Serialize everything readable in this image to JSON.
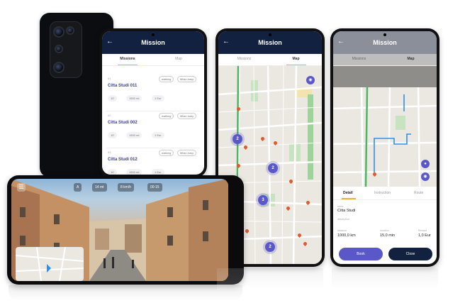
{
  "missions_screen": {
    "back_icon": "arrow-left-icon",
    "title": "Mission",
    "tabs": [
      "Missions",
      "Map"
    ],
    "missions": [
      {
        "number": "#1",
        "tags": [
          "walking",
          "Milan easy"
        ],
        "name": "Citta Studi 011",
        "stats": [
          "10'",
          "1500 mt",
          "1 Eur"
        ]
      },
      {
        "number": "#2",
        "tags": [
          "walking",
          "Milan easy"
        ],
        "name": "Citta Studi 002",
        "stats": [
          "10'",
          "1500 mt",
          "1 Eur"
        ]
      },
      {
        "number": "#3",
        "tags": [
          "walking",
          "Milan easy"
        ],
        "name": "Citta Studi 012",
        "stats": [
          "10'",
          "1500 mt",
          "1 Eur"
        ]
      }
    ]
  },
  "map_screen": {
    "title": "Mission",
    "tabs": [
      "Missions",
      "Map"
    ],
    "clusters": [
      "2",
      "2",
      "3",
      "2"
    ]
  },
  "detail_screen": {
    "title": "Mission",
    "tabs": [
      "Missions",
      "Map"
    ],
    "sheet_tabs": [
      "Detail",
      "Instruction",
      "Route"
    ],
    "name_label": "name",
    "name": "Citta Studi",
    "description_label": "description",
    "stats": [
      {
        "label": "distance",
        "value": "1000,0 km"
      },
      {
        "label": "duration",
        "value": "15,0 min"
      },
      {
        "label": "Reward",
        "value": "1,0 Eur"
      }
    ],
    "book_label": "Book",
    "close_label": "Close",
    "colors": {
      "book": "#5a58c8",
      "close": "#12213f"
    }
  },
  "ar_screen": {
    "hud": [
      "A",
      "14 mt",
      "8 km/h",
      "00:15"
    ]
  },
  "colors": {
    "header": "#12213f",
    "accent": "#5a58c8",
    "tab_underline": "#e6b23a",
    "pin": "#e05a2b"
  }
}
